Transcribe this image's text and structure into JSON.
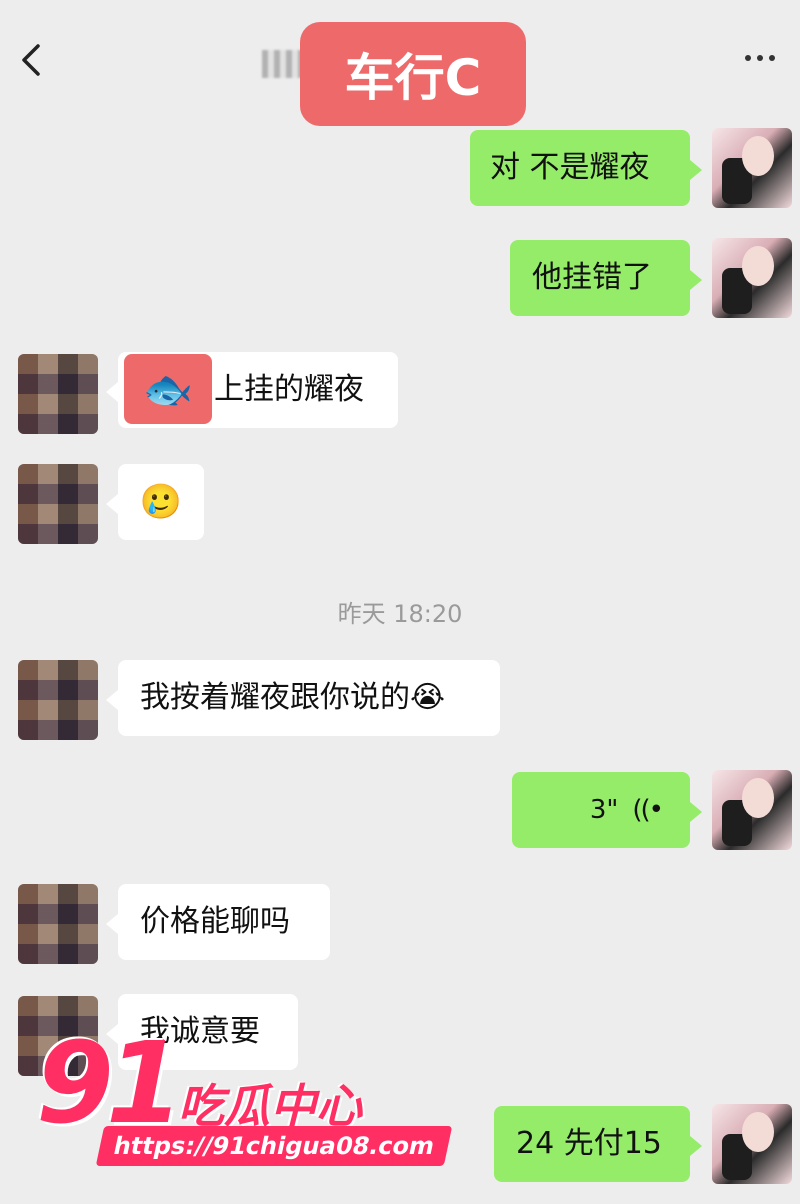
{
  "header": {
    "back_icon": "chevron-left-icon",
    "title": "车行C",
    "more_icon": "more-dots-icon"
  },
  "messages": [
    {
      "side": "right",
      "text": "对 不是耀夜"
    },
    {
      "side": "right",
      "text": "他挂错了"
    },
    {
      "side": "left",
      "sticker": "fish-emoji",
      "text": "上挂的耀夜"
    },
    {
      "side": "left",
      "emoji": "🥲"
    },
    {
      "side": "left",
      "text": "我按着耀夜跟你说的😭"
    },
    {
      "side": "right",
      "voice_duration": "3\"",
      "voice_icon": "voice-wave-icon"
    },
    {
      "side": "left",
      "text": "价格能聊吗"
    },
    {
      "side": "left",
      "text": "我诚意要"
    },
    {
      "side": "right",
      "text": "24 先付15"
    }
  ],
  "timestamp": "昨天 18:20",
  "watermark": {
    "number": "91",
    "name": "吃瓜中心",
    "url": "https://91chigua08.com"
  },
  "colors": {
    "background": "#ededed",
    "self_bubble": "#95ec69",
    "other_bubble": "#ffffff",
    "title_badge": "#ee6a6a",
    "watermark": "#ff2f63"
  }
}
